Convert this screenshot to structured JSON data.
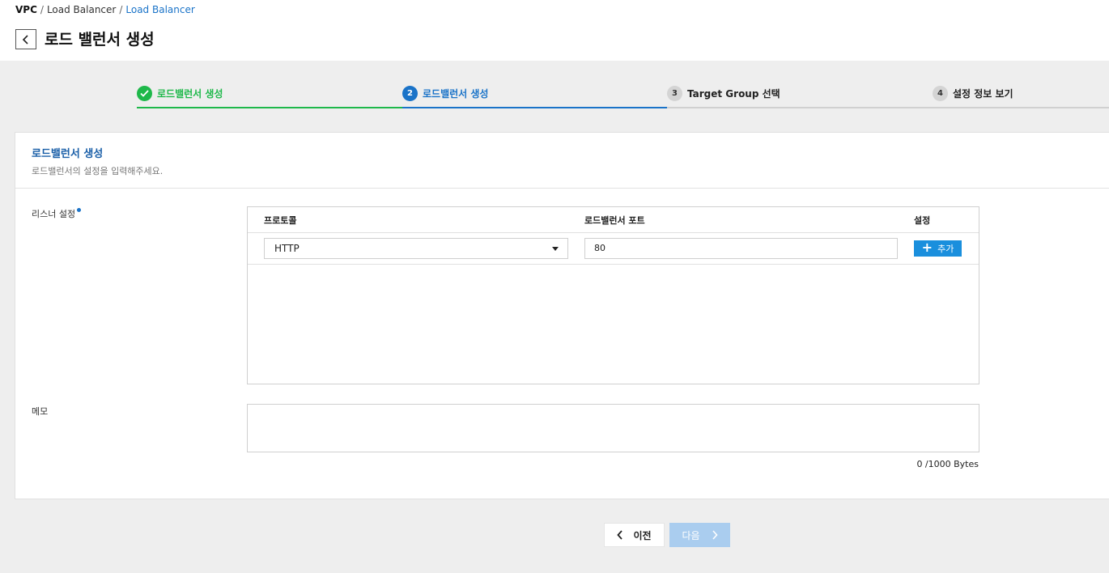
{
  "breadcrumb": [
    "VPC",
    "Load Balancer",
    "Load Balancer"
  ],
  "page_title": "로드 밸런서 생성",
  "steps": [
    {
      "number": "",
      "label": "로드밸런서 생성",
      "state": "done"
    },
    {
      "number": "2",
      "label": "로드밸런서 생성",
      "state": "active"
    },
    {
      "number": "3",
      "label": "Target Group 선택",
      "state": "todo"
    },
    {
      "number": "4",
      "label": "설정 정보 보기",
      "state": "todo"
    }
  ],
  "section": {
    "title": "로드밸런서 생성",
    "description": "로드밸런서의 설정을 입력해주세요."
  },
  "listener": {
    "label": "리스너 설정",
    "headers": {
      "protocol": "프로토콜",
      "port": "로드밸런서 포트",
      "settings": "설정"
    },
    "protocol_value": "HTTP",
    "port_value": "80",
    "add_label": "추가"
  },
  "memo": {
    "label": "메모",
    "value": "",
    "byte_count": "0 /1000 Bytes"
  },
  "buttons": {
    "prev": "이전",
    "next": "다음"
  },
  "colors": {
    "accent": "#1a73c8",
    "success": "#1eb84a",
    "add_button": "#1a8fdd",
    "next_disabled": "#aacdef"
  }
}
